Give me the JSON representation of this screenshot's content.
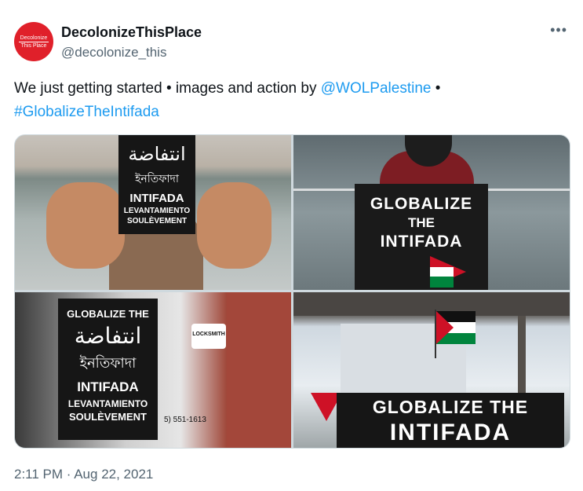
{
  "account": {
    "avatar_line1": "Decolonize",
    "avatar_line2": "This Place",
    "display_name": "DecolonizeThisPlace",
    "handle": "@decolonize_this"
  },
  "more_label": "•••",
  "tweet": {
    "text_before": "We just getting started • images and action by ",
    "mention": "@WOLPalestine",
    "text_after": " •",
    "hashtag": "#GlobalizeTheIntifada"
  },
  "media": {
    "photo1": {
      "arabic": "انتفاضة",
      "bengali": "ইনতিফাদা",
      "line1": "INTIFADA",
      "line2": "LEVANTAMIENTO",
      "line3": "SOULÈVEMENT"
    },
    "photo2": {
      "line1": "GLOBALIZE",
      "line2": "THE",
      "line3": "INTIFADA"
    },
    "photo3": {
      "line0": "GLOBALIZE THE",
      "arabic": "انتفاضة",
      "bengali": "ইনতিফাদা",
      "line1": "INTIFADA",
      "line2": "LEVANTAMIENTO",
      "line3": "SOULÈVEMENT",
      "locksmith": "LOCKSMITH",
      "phone": "5) 551-1613"
    },
    "photo4": {
      "line1": "GLOBALIZE THE",
      "line2": "INTIFADA"
    }
  },
  "timestamp": "2:11 PM · Aug 22, 2021",
  "colors": {
    "link": "#1d9bf0",
    "text": "#0f1419",
    "muted": "#536471",
    "avatar": "#e0202a"
  }
}
